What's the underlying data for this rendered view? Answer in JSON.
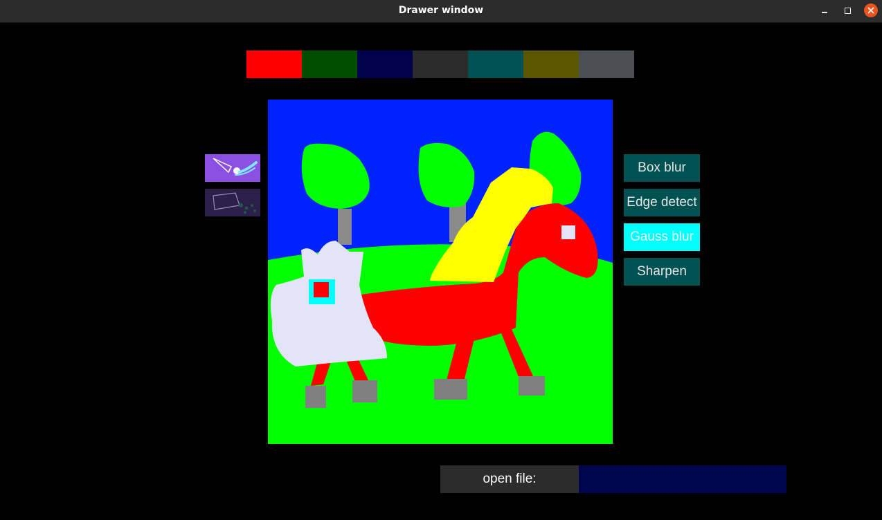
{
  "window": {
    "title": "Drawer window"
  },
  "window_controls": {
    "minimize_icon": "minimize-icon",
    "maximize_icon": "maximize-icon",
    "close_icon": "close-icon"
  },
  "palette": {
    "colors": [
      "#ff0000",
      "#004d00",
      "#00004d",
      "#2c2c2c",
      "#005151",
      "#5b5600",
      "#4e4e55"
    ]
  },
  "tools": [
    {
      "icon": "brush-icon",
      "color": "#8b4fe3"
    },
    {
      "icon": "eraser-icon",
      "color": "#2c1f4a"
    }
  ],
  "filters": {
    "buttons": [
      {
        "label": "Box blur",
        "bg": "#005151",
        "fg": "#e6e6e6"
      },
      {
        "label": "Edge detect",
        "bg": "#005151",
        "fg": "#e6e6e6"
      },
      {
        "label": "Gauss blur",
        "bg": "#00ffff",
        "fg": "#e6ffff"
      },
      {
        "label": "Sharpen",
        "bg": "#005151",
        "fg": "#e6e6e6"
      }
    ]
  },
  "open_file": {
    "label": "open file:",
    "value": ""
  },
  "canvas": {
    "sky_color": "#0022ff",
    "grass_color": "#00ff00",
    "colors": {
      "tree": "#00ff00",
      "trunk": "#8a8a8a",
      "lion": "#e4e4f7",
      "horse": "#ff0000",
      "mane": "#ffff00",
      "hoof": "#808080",
      "eye_ring": "#00ffff"
    }
  }
}
